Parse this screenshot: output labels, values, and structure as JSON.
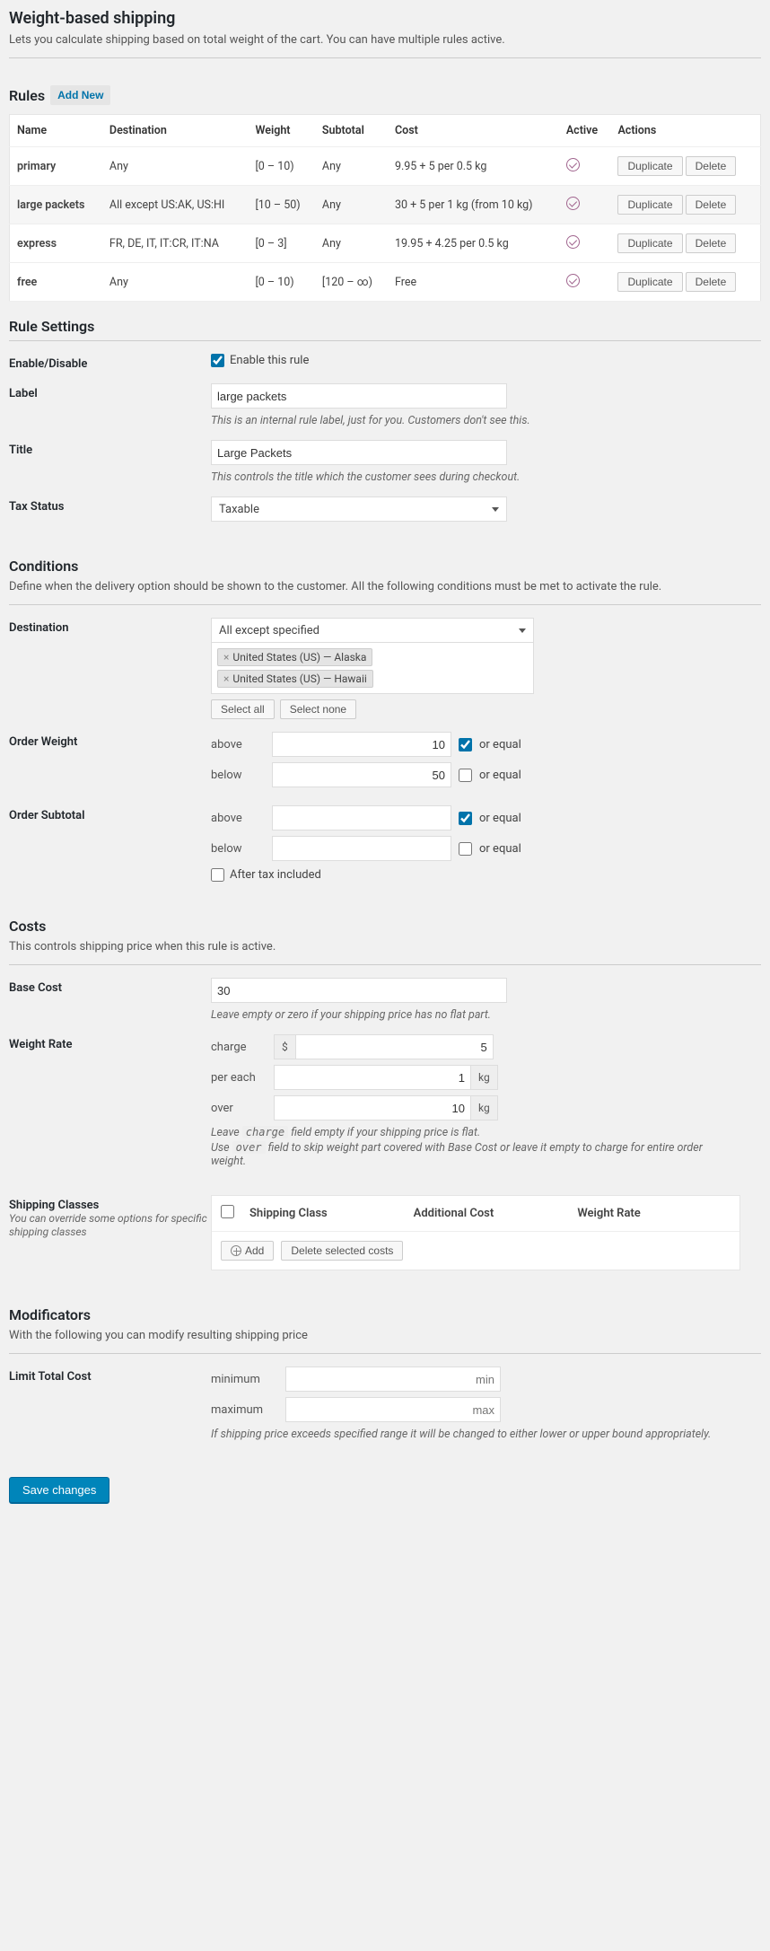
{
  "page": {
    "title": "Weight-based shipping",
    "subtitle": "Lets you calculate shipping based on total weight of the cart. You can have multiple rules active."
  },
  "rules": {
    "heading": "Rules",
    "add_new": "Add New",
    "columns": {
      "name": "Name",
      "destination": "Destination",
      "weight": "Weight",
      "subtotal": "Subtotal",
      "cost": "Cost",
      "active": "Active",
      "actions": "Actions"
    },
    "duplicate": "Duplicate",
    "delete": "Delete",
    "items": [
      {
        "name": "primary",
        "destination": "Any",
        "weight": "[0 – 10)",
        "subtotal": "Any",
        "cost": "9.95 + 5 per 0.5 kg",
        "selected": false
      },
      {
        "name": "large packets",
        "destination": "All except US:AK, US:HI",
        "weight": "[10 – 50)",
        "subtotal": "Any",
        "cost": "30 + 5 per 1 kg (from 10 kg)",
        "selected": true
      },
      {
        "name": "express",
        "destination": "FR, DE, IT, IT:CR, IT:NA",
        "weight": "[0 – 3]",
        "subtotal": "Any",
        "cost": "19.95 + 4.25 per 0.5 kg",
        "selected": false
      },
      {
        "name": "free",
        "destination": "Any",
        "weight": "[0 – 10)",
        "subtotal": "[120 – ∞)",
        "cost": "Free",
        "selected": false
      }
    ]
  },
  "settings": {
    "heading": "Rule Settings",
    "enable": {
      "label": "Enable/Disable",
      "checkbox_label": "Enable this rule",
      "checked": true
    },
    "label_field": {
      "label": "Label",
      "value": "large packets",
      "hint": "This is an internal rule label, just for you. Customers don't see this."
    },
    "title_field": {
      "label": "Title",
      "value": "Large Packets",
      "hint": "This controls the title which the customer sees during checkout."
    },
    "tax": {
      "label": "Tax Status",
      "value": "Taxable"
    }
  },
  "conditions": {
    "heading": "Conditions",
    "sub": "Define when the delivery option should be shown to the customer. All the following conditions must be met to activate the rule.",
    "destination": {
      "label": "Destination",
      "mode": "All except specified",
      "tags": [
        "United States (US) — Alaska",
        "United States (US) — Hawaii"
      ],
      "select_all": "Select all",
      "select_none": "Select none"
    },
    "weight": {
      "label": "Order Weight",
      "above": "above",
      "below": "below",
      "or_equal": "or equal",
      "above_val": "10",
      "below_val": "50",
      "above_eq": true,
      "below_eq": false
    },
    "subtotal": {
      "label": "Order Subtotal",
      "above": "above",
      "below": "below",
      "or_equal": "or equal",
      "above_val": "",
      "below_val": "",
      "above_eq": true,
      "below_eq": false,
      "after_tax": "After tax included",
      "after_tax_checked": false
    }
  },
  "costs": {
    "heading": "Costs",
    "sub": "This controls shipping price when this rule is active.",
    "base": {
      "label": "Base Cost",
      "value": "30",
      "hint": "Leave empty or zero if your shipping price has no flat part."
    },
    "rate": {
      "label": "Weight Rate",
      "charge": "charge",
      "per_each": "per each",
      "over": "over",
      "currency": "$",
      "kg": "kg",
      "charge_val": "5",
      "per_each_val": "1",
      "over_val": "10",
      "hint1_a": "Leave ",
      "hint1_code": "charge",
      "hint1_b": " field empty if your shipping price is flat.",
      "hint2_a": "Use ",
      "hint2_code": "over",
      "hint2_b": " field to skip weight part covered with Base Cost or leave it empty to charge for entire order weight."
    },
    "classes": {
      "label": "Shipping Classes",
      "sublabel": "You can override some options for specific shipping classes",
      "col1": "Shipping Class",
      "col2": "Additional Cost",
      "col3": "Weight Rate",
      "add": "Add",
      "delete": "Delete selected costs"
    }
  },
  "mods": {
    "heading": "Modificators",
    "sub": "With the following you can modify resulting shipping price",
    "limit": {
      "label": "Limit Total Cost",
      "min": "minimum",
      "max": "maximum",
      "min_ph": "min",
      "max_ph": "max",
      "hint": "If shipping price exceeds specified range it will be changed to either lower or upper bound appropriately."
    }
  },
  "save": "Save changes"
}
